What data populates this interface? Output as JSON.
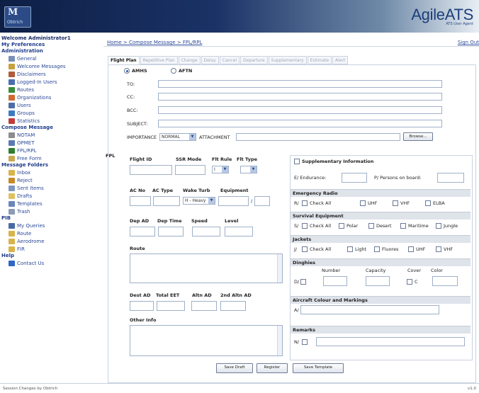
{
  "header": {
    "logo_left_mark": "M",
    "logo_left_name": "Obtrich",
    "logo_right_title": "AgileATS",
    "logo_right_sub": "ATS User Agent"
  },
  "sidebar": {
    "welcome": "Welcome Administrator1",
    "preferences": "My Preferences",
    "admin_head": "Administration",
    "admin_items": [
      {
        "label": "General",
        "color": "#7a8fb8"
      },
      {
        "label": "Welcome Messages",
        "color": "#c9a040"
      },
      {
        "label": "Disclaimers",
        "color": "#b25b3a"
      },
      {
        "label": "Logged-In Users",
        "color": "#4a6fb0"
      },
      {
        "label": "Routes",
        "color": "#3a8c3a"
      },
      {
        "label": "Organizations",
        "color": "#d06a30"
      },
      {
        "label": "Users",
        "color": "#4b6ea6"
      },
      {
        "label": "Groups",
        "color": "#3f7bbf"
      },
      {
        "label": "Statistics",
        "color": "#c23b3b"
      }
    ],
    "compose_head": "Compose Message",
    "compose_items": [
      {
        "label": "NOTAM",
        "color": "#8c8c8c"
      },
      {
        "label": "OPMET",
        "color": "#5a7ab5"
      },
      {
        "label": "FPL/RPL",
        "color": "#2f7d2f"
      },
      {
        "label": "Free Form",
        "color": "#c8a850"
      }
    ],
    "folders_head": "Message Folders",
    "folder_items": [
      {
        "label": "Inbox",
        "color": "#d9b44a"
      },
      {
        "label": "Reject",
        "color": "#c78a2a"
      },
      {
        "label": "Sent Items",
        "color": "#7f97c0"
      },
      {
        "label": "Drafts",
        "color": "#e0c060"
      },
      {
        "label": "Templates",
        "color": "#6a85b8"
      },
      {
        "label": "Trash",
        "color": "#8d9cb5"
      }
    ],
    "pib_head": "PIB",
    "pib_items": [
      {
        "label": "My Queries",
        "color": "#4a6aa5"
      },
      {
        "label": "Route",
        "color": "#d9b44a"
      },
      {
        "label": "Aerodrome",
        "color": "#d9b44a"
      },
      {
        "label": "FIR",
        "color": "#d9b44a"
      }
    ],
    "help_head": "Help",
    "help_items": [
      {
        "label": "Contact Us",
        "color": "#2f66c6"
      }
    ]
  },
  "breadcrumb": "Home > Compose Message > FPL/RPL",
  "signout": "Sign Out",
  "tabs": [
    "Flight Plan",
    "Repetitive Plan",
    "Change",
    "Delay",
    "Cancel",
    "Departure",
    "Supplementary",
    "Estimate",
    "Alert"
  ],
  "form": {
    "radio_aftn_label": "AMHS",
    "radio_amhs_label": "AFTN",
    "to_label": "TO:",
    "cc_label": "CC:",
    "bcc_label": "BCC:",
    "subject_label": "SUBJECT:",
    "importance_label": "IMPORTANCE",
    "importance_value": "NORMAL",
    "attachment_label": "ATTACHMENT",
    "browse_label": "Browse...",
    "fpl_label": "FPL",
    "flight_id_label": "Flight ID",
    "ssr_mode_label": "SSR Mode",
    "flt_rule_label": "Flt Rule",
    "flt_type_label": "Flt Type",
    "ssr_mode_value": "",
    "flt_rule_value": "I",
    "flt_type_value": "",
    "ac_no_label": "AC No",
    "ac_type_label": "AC Type",
    "wake_turb_label": "Wake Turb",
    "equipment_label": "Equipment",
    "wake_turb_value": "H - Heavy",
    "dep_ad_label": "Dep AD",
    "dep_time_label": "Dep Time",
    "speed_label": "Speed",
    "level_label": "Level",
    "route_label": "Route",
    "dest_ad_label": "Dest AD",
    "total_eet_label": "Total EET",
    "altn_ad_label": "Altn AD",
    "altn2_label": "2nd Altn AD",
    "other_info_label": "Other Info",
    "supp_label": "Supplementary Information",
    "endurance_label": "E/ Endurance:",
    "persons_label": "P/ Persons on board:",
    "emergency_head": "Emergency Radio",
    "emergency_opts": [
      "R/",
      "Check All",
      "UHF",
      "VHF",
      "ELBA"
    ],
    "survival_head": "Survival Equipment",
    "survival_opts": [
      "S/",
      "Check All",
      "Polar",
      "Desert",
      "Maritime",
      "Jungle"
    ],
    "jackets_head": "Jackets",
    "jackets_opts": [
      "J/",
      "Check All",
      "Light",
      "Fluores",
      "UHF",
      "VHF"
    ],
    "dinghies_head": "Dinghies",
    "dinghies_cols": [
      "Number",
      "Capacity",
      "Cover",
      "Color"
    ],
    "dinghies_prefix": "D/",
    "dinghies_cover": "C",
    "aircraft_head": "Aircraft Colour and Markings",
    "aircraft_prefix": "A/",
    "remarks_head": "Remarks",
    "remarks_prefix": "N/",
    "save_draft": "Save Draft",
    "register": "Register",
    "save_template": "Save Template"
  },
  "footer": {
    "left": "Session Changes by Obtrich",
    "right": "v1.0"
  }
}
